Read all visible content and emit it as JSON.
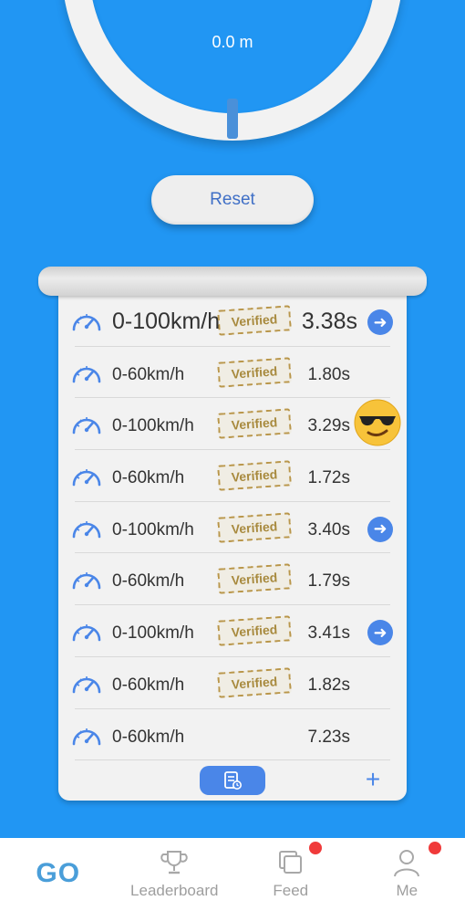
{
  "gauge": {
    "distance": "0.0 m"
  },
  "reset_label": "Reset",
  "records": [
    {
      "label": "0-100km/h",
      "verified": "Verified",
      "time": "3.38s",
      "action": "arrow",
      "emphasis": true
    },
    {
      "label": "0-60km/h",
      "verified": "Verified",
      "time": "1.80s",
      "action": "none"
    },
    {
      "label": "0-100km/h",
      "verified": "Verified",
      "time": "3.29s",
      "action": "cool-face"
    },
    {
      "label": "0-60km/h",
      "verified": "Verified",
      "time": "1.72s",
      "action": "none"
    },
    {
      "label": "0-100km/h",
      "verified": "Verified",
      "time": "3.40s",
      "action": "arrow"
    },
    {
      "label": "0-60km/h",
      "verified": "Verified",
      "time": "1.79s",
      "action": "none"
    },
    {
      "label": "0-100km/h",
      "verified": "Verified",
      "time": "3.41s",
      "action": "arrow"
    },
    {
      "label": "0-60km/h",
      "verified": "Verified",
      "time": "1.82s",
      "action": "none"
    },
    {
      "label": "0-60km/h",
      "verified": "",
      "time": "7.23s",
      "action": "none"
    }
  ],
  "toolbar": {
    "history_icon": "history-icon",
    "add_label": "+"
  },
  "nav": {
    "go": "GO",
    "leaderboard": "Leaderboard",
    "feed": "Feed",
    "me": "Me",
    "feed_badge": true,
    "me_badge": true
  },
  "colors": {
    "background": "#2196F3",
    "accent": "#4a86e8",
    "badge": "#f03a3a",
    "stamp": "#a88a3e"
  }
}
